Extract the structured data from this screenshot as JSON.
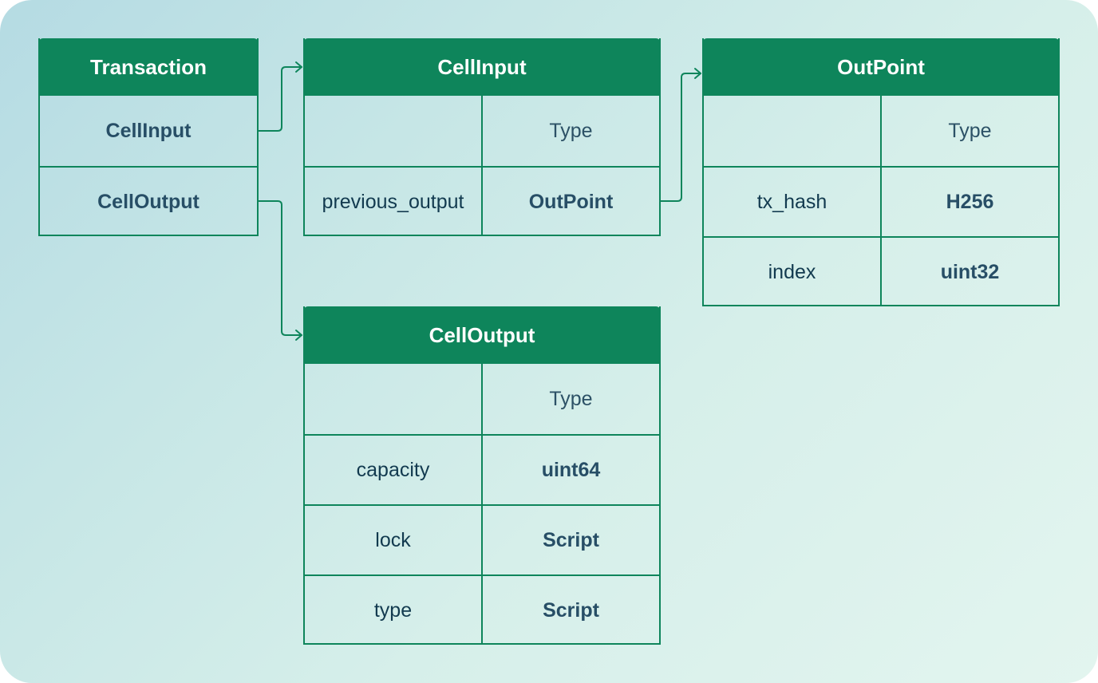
{
  "colors": {
    "header_bg": "#0e855b",
    "border": "#0e855b",
    "text": "#123a4f",
    "type_text": "#274e66"
  },
  "tables": {
    "transaction": {
      "title": "Transaction",
      "rows": [
        "CellInput",
        "CellOutput"
      ]
    },
    "cell_input": {
      "title": "CellInput",
      "type_header": "Type",
      "rows": [
        {
          "field": "previous_output",
          "type": "OutPoint"
        }
      ]
    },
    "out_point": {
      "title": "OutPoint",
      "type_header": "Type",
      "rows": [
        {
          "field": "tx_hash",
          "type": "H256"
        },
        {
          "field": "index",
          "type": "uint32"
        }
      ]
    },
    "cell_output": {
      "title": "CellOutput",
      "type_header": "Type",
      "rows": [
        {
          "field": "capacity",
          "type": "uint64"
        },
        {
          "field": "lock",
          "type": "Script"
        },
        {
          "field": "type",
          "type": "Script"
        }
      ]
    }
  },
  "connections": [
    {
      "from": "Transaction.CellInput",
      "to": "CellInput"
    },
    {
      "from": "Transaction.CellOutput",
      "to": "CellOutput"
    },
    {
      "from": "CellInput.previous_output",
      "to": "OutPoint"
    }
  ]
}
